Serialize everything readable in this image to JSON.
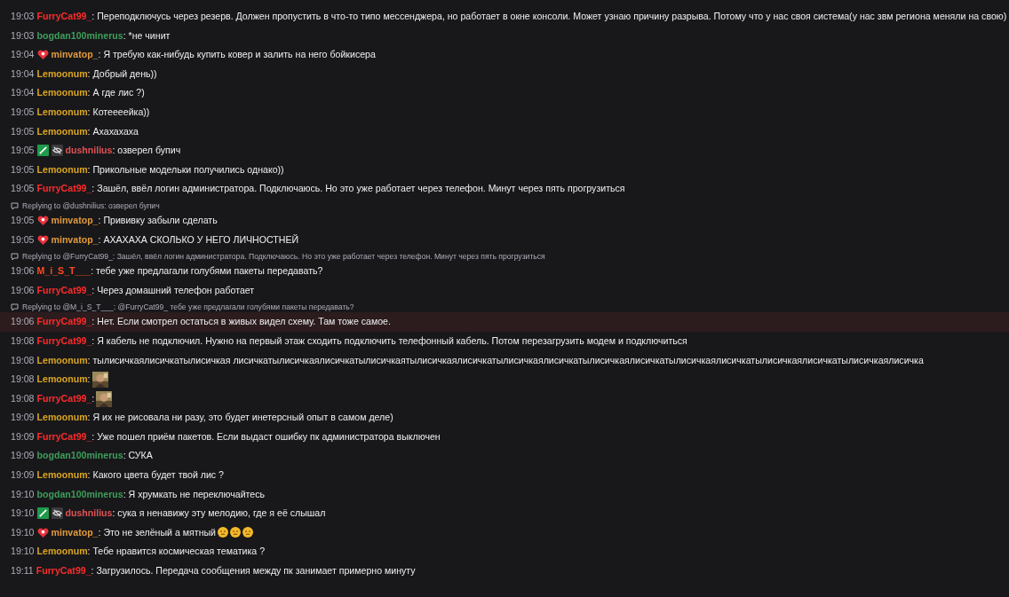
{
  "messages": [
    {
      "time": "19:03",
      "user": "FurryCat99_",
      "color": "#ff2b2b",
      "text": ": Переподключусь через резерв. Должен пропустить в что-то типо мессенджера, но работает в окне консоли. Может узнаю причину разрыва. Потому что у нас своя система(у нас звм региона меняли на свою)",
      "highlighted": false
    },
    {
      "time": "19:03",
      "user": "bogdan100minerus",
      "color": "#3f9e5a",
      "text": ": *не чинит",
      "highlighted": false
    },
    {
      "time": "19:04",
      "user": "minvatop_",
      "color": "#e39a3b",
      "badges": [
        {
          "kind": "heart"
        }
      ],
      "text": ": Я требую как-нибудь купить ковер и залить на него бойкисера",
      "highlighted": false
    },
    {
      "time": "19:04",
      "user": "Lemoonum",
      "color": "#daa520",
      "text": ": Добрый день))",
      "highlighted": false
    },
    {
      "time": "19:04",
      "user": "Lemoonum",
      "color": "#daa520",
      "text": ": А где лис ?)",
      "highlighted": false
    },
    {
      "time": "19:05",
      "user": "Lemoonum",
      "color": "#daa520",
      "text": ": Котеееейка))",
      "highlighted": false
    },
    {
      "time": "19:05",
      "user": "Lemoonum",
      "color": "#daa520",
      "text": ": Ахахахаха",
      "highlighted": false
    },
    {
      "time": "19:05",
      "user": "dushnilius",
      "color": "#e05252",
      "badges": [
        {
          "kind": "sword"
        },
        {
          "kind": "hidden"
        }
      ],
      "text": ": озверел бупич",
      "highlighted": false
    },
    {
      "time": "19:05",
      "user": "Lemoonum",
      "color": "#daa520",
      "text": ": Прикольные модельки получились однако))",
      "highlighted": false
    },
    {
      "time": "19:05",
      "user": "FurryCat99_",
      "color": "#ff2b2b",
      "text": ": Зашёл, ввёл логин администратора. Подключаюсь. Но это уже работает через телефон. Минут через пять прогрузиться",
      "highlighted": false
    },
    {
      "reply": "Replying to @dushnilius: озверел бупич",
      "time": "19:05",
      "user": "minvatop_",
      "color": "#e39a3b",
      "badges": [
        {
          "kind": "heart"
        }
      ],
      "text": ": Прививку забыли сделать",
      "highlighted": false
    },
    {
      "time": "19:05",
      "user": "minvatop_",
      "color": "#e39a3b",
      "badges": [
        {
          "kind": "heart"
        }
      ],
      "text": ": АХАХАХА СКОЛЬКО У НЕГО ЛИЧНОСТНЕЙ",
      "highlighted": false
    },
    {
      "reply": "Replying to @FurryCat99_: Зашёл, ввёл логин администратора. Подключаюсь. Но это уже работает через телефон. Минут через пять прогрузиться",
      "time": "19:06",
      "user": "M_i_S_T___",
      "color": "#ff4a1c",
      "text": ": тебе уже предлагали голубями пакеты передавать?",
      "highlighted": false
    },
    {
      "time": "19:06",
      "user": "FurryCat99_",
      "color": "#ff2b2b",
      "text": ": Через домашний телефон работает",
      "highlighted": false
    },
    {
      "reply": "Replying to @M_i_S_T___: @FurryCat99_ тебе уже предлагали голубями пакеты передавать?",
      "time": "19:06",
      "user": "FurryCat99_",
      "color": "#ff2b2b",
      "text": ": Нет. Если смотрел остаться в живых видел схему. Там тоже самое.",
      "highlighted": true
    },
    {
      "time": "19:08",
      "user": "FurryCat99_",
      "color": "#ff2b2b",
      "text": ": Я кабель не подключил. Нужно на первый этаж сходить подключить телефонный кабель. Потом перезагрузить модем и подключиться",
      "highlighted": false
    },
    {
      "time": "19:08",
      "user": "Lemoonum",
      "color": "#daa520",
      "text": ": тылисичкаялисичкатылисичкая лисичкатылисичкаялисичкатылисичкаятылисичкаялисичкатылисичкаялисичкатылисичкаялисичкатылисичкаялисичкатылисичкаялисичкатылисичкаялисичка",
      "highlighted": false
    },
    {
      "time": "19:08",
      "user": "Lemoonum",
      "color": "#daa520",
      "text": ":",
      "highlighted": false
    },
    {
      "time": "19:08",
      "user": "FurryCat99_",
      "color": "#ff2b2b",
      "text": ":",
      "highlighted": false
    },
    {
      "time": "19:09",
      "user": "Lemoonum",
      "color": "#daa520",
      "text": ": Я их не рисовала ни разу, это будет инетерсный опыт в самом деле)",
      "highlighted": false
    },
    {
      "time": "19:09",
      "user": "FurryCat99_",
      "color": "#ff2b2b",
      "text": ": Уже пошел приём пакетов. Если выдаст ошибку пк администратора выключен",
      "highlighted": false
    },
    {
      "time": "19:09",
      "user": "bogdan100minerus",
      "color": "#3f9e5a",
      "text": ": СУКА",
      "highlighted": false
    },
    {
      "time": "19:09",
      "user": "Lemoonum",
      "color": "#daa520",
      "text": ": Какого цвета будет твой лис ?",
      "highlighted": false
    },
    {
      "time": "19:10",
      "user": "bogdan100minerus",
      "color": "#3f9e5a",
      "text": ": Я хрумкать не переключайтесь",
      "highlighted": false
    },
    {
      "time": "19:10",
      "user": "dushnilius",
      "color": "#e05252",
      "badges": [
        {
          "kind": "sword"
        },
        {
          "kind": "hidden"
        }
      ],
      "text": ": сука я ненавижу эту мелодию, где я её слышал",
      "highlighted": false
    },
    {
      "time": "19:10",
      "user": "minvatop_",
      "color": "#e39a3b",
      "badges": [
        {
          "kind": "heart"
        }
      ],
      "text": ": Это не зелёный а мятный",
      "emotes": [
        {
          "kind": "smiley"
        },
        {
          "kind": "smiley"
        },
        {
          "kind": "smiley"
        }
      ],
      "highlighted": false
    },
    {
      "time": "19:10",
      "user": "Lemoonum",
      "color": "#daa520",
      "text": ": Тебе нравится космическая тематика ?",
      "highlighted": false
    },
    {
      "time": "19:11",
      "user": "FurryCat99_",
      "color": "#ff2b2b",
      "text": ": Загрузилось. Передача сообщения между пк занимает примерно минуту",
      "highlighted": false
    }
  ]
}
